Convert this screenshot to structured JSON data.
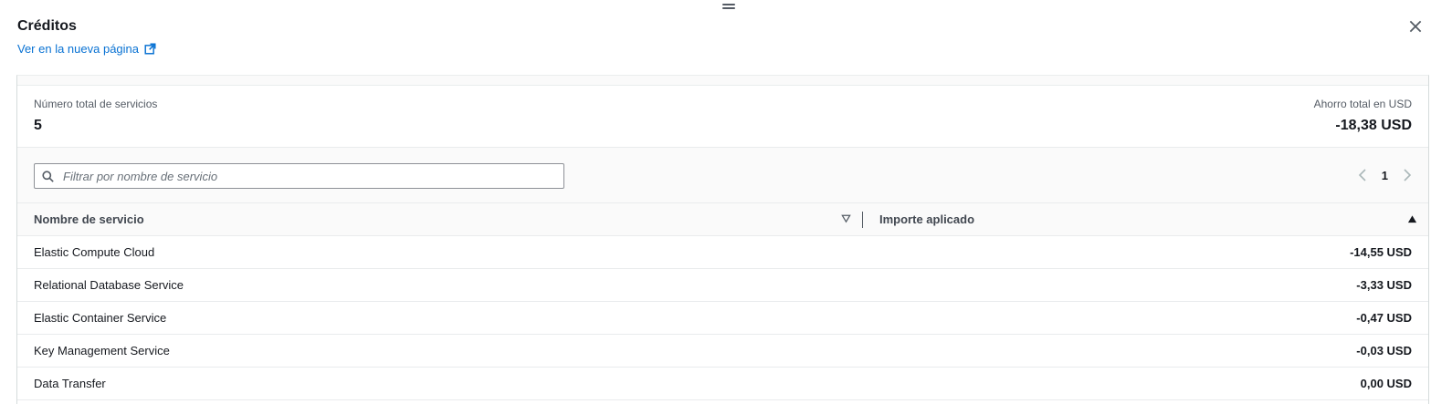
{
  "header": {
    "title": "Créditos",
    "external_link": "Ver en la nueva página",
    "close_icon": "close-icon",
    "drag_icon": "drag-handle-icon"
  },
  "summary": {
    "services_label": "Número total de servicios",
    "services_value": "5",
    "savings_label": "Ahorro total en USD",
    "savings_value": "-18,38 USD"
  },
  "filter": {
    "placeholder": "Filtrar por nombre de servicio",
    "value": ""
  },
  "pagination": {
    "current_page": "1"
  },
  "table": {
    "columns": [
      "Nombre de servicio",
      "Importe aplicado"
    ],
    "rows": [
      {
        "service": "Elastic Compute Cloud",
        "amount": "-14,55 USD"
      },
      {
        "service": "Relational Database Service",
        "amount": "-3,33 USD"
      },
      {
        "service": "Elastic Container Service",
        "amount": "-0,47 USD"
      },
      {
        "service": "Key Management Service",
        "amount": "-0,03 USD"
      },
      {
        "service": "Data Transfer",
        "amount": "0,00 USD"
      }
    ]
  },
  "colors": {
    "link": "#0972d3",
    "text": "#16191f",
    "secondary_text": "#545b64",
    "header_bg": "#fafafa"
  }
}
